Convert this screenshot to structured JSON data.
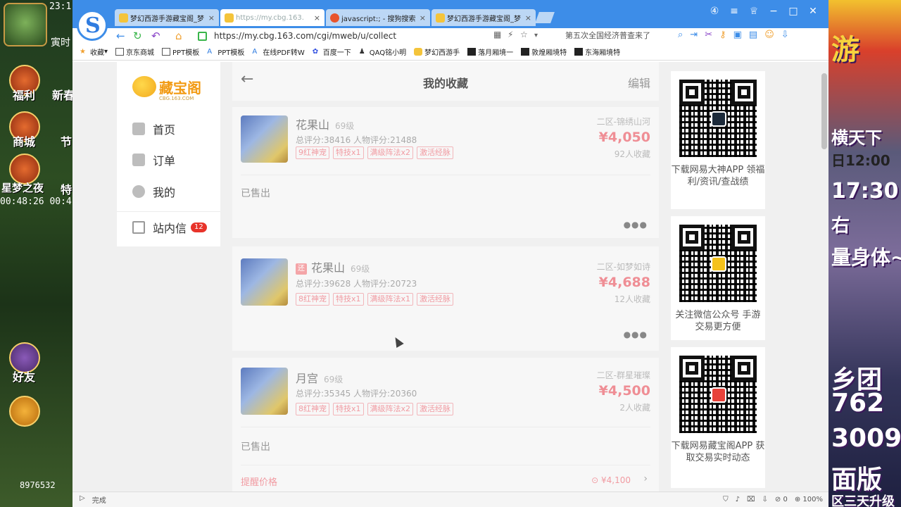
{
  "game_left": {
    "clock": "23:1",
    "sub": "寅时",
    "items": [
      "福利",
      "新春",
      "商城",
      "节",
      "星梦之夜",
      "特"
    ],
    "timer": "00:48:26 00:4",
    "friends": "好友",
    "id_number": "8976532"
  },
  "game_right": {
    "lines": [
      "游",
      "横天下",
      "日12:00",
      "17:30",
      "右",
      "量身体~",
      "乡团",
      "762",
      "3009",
      "面版",
      "区三天升级"
    ]
  },
  "tabs": [
    {
      "title": "梦幻西游手游藏宝阁_梦",
      "close": "×"
    },
    {
      "title": "https://my.cbg.163.",
      "close": "×"
    },
    {
      "title": "javascript:; - 搜狗搜索",
      "close": "×"
    },
    {
      "title": "梦幻西游手游藏宝阁_梦",
      "close": "×"
    }
  ],
  "address": {
    "url": "https://my.cbg.163.com/cgi/mweb/u/collect",
    "search_hint": "第五次全国经济普查来了"
  },
  "bookmarks": [
    "收藏",
    "京东商城",
    "PPT模板",
    "PPT模板",
    "在线PDF转W",
    "百度一下",
    "QAQ铭小明",
    "梦幻西游手",
    "落月厢境一",
    "敦煌厢境特",
    "东海厢境特"
  ],
  "nav": {
    "logo": "藏宝阁",
    "logo_sub": "CBG.163.COM",
    "items": [
      "首页",
      "订单",
      "我的",
      "站内信"
    ],
    "unread": "12"
  },
  "main": {
    "title": "我的收藏",
    "edit": "编辑",
    "back": "←"
  },
  "cards": [
    {
      "name": "花果山",
      "level": "69级",
      "score": "总评分:38416   人物评分:21488",
      "tags": [
        "9红神宠",
        "特技x1",
        "满级阵法x2",
        "激活经脉"
      ],
      "server": "二区-锦绣山河",
      "price": "¥4,050",
      "favs": "92人收藏",
      "status": "已售出",
      "returned": ""
    },
    {
      "name": "花果山",
      "level": "69级",
      "score": "总评分:39628   人物评分:20723",
      "tags": [
        "8红神宠",
        "特技x1",
        "满级阵法x1",
        "激活经脉"
      ],
      "server": "二区-如梦如诗",
      "price": "¥4,688",
      "favs": "12人收藏",
      "status": "",
      "returned": "还"
    },
    {
      "name": "月宫",
      "level": "69级",
      "score": "总评分:35345   人物评分:20360",
      "tags": [
        "8红神宠",
        "特技x1",
        "满级阵法x2",
        "激活经脉"
      ],
      "server": "二区-群星璀璨",
      "price": "¥4,500",
      "favs": "2人收藏",
      "status": "已售出",
      "returned": ""
    }
  ],
  "remind": {
    "label": "提醒价格",
    "price": "¥4,100"
  },
  "qr": [
    {
      "caption": "下载网易大神APP 领福利/资讯/查战绩"
    },
    {
      "caption": "关注微信公众号 手游交易更方便"
    },
    {
      "caption": "下载网易藏宝阁APP 获取交易实时动态"
    }
  ],
  "status": {
    "left": "完成",
    "zoom": "100%",
    "counter": "0"
  }
}
